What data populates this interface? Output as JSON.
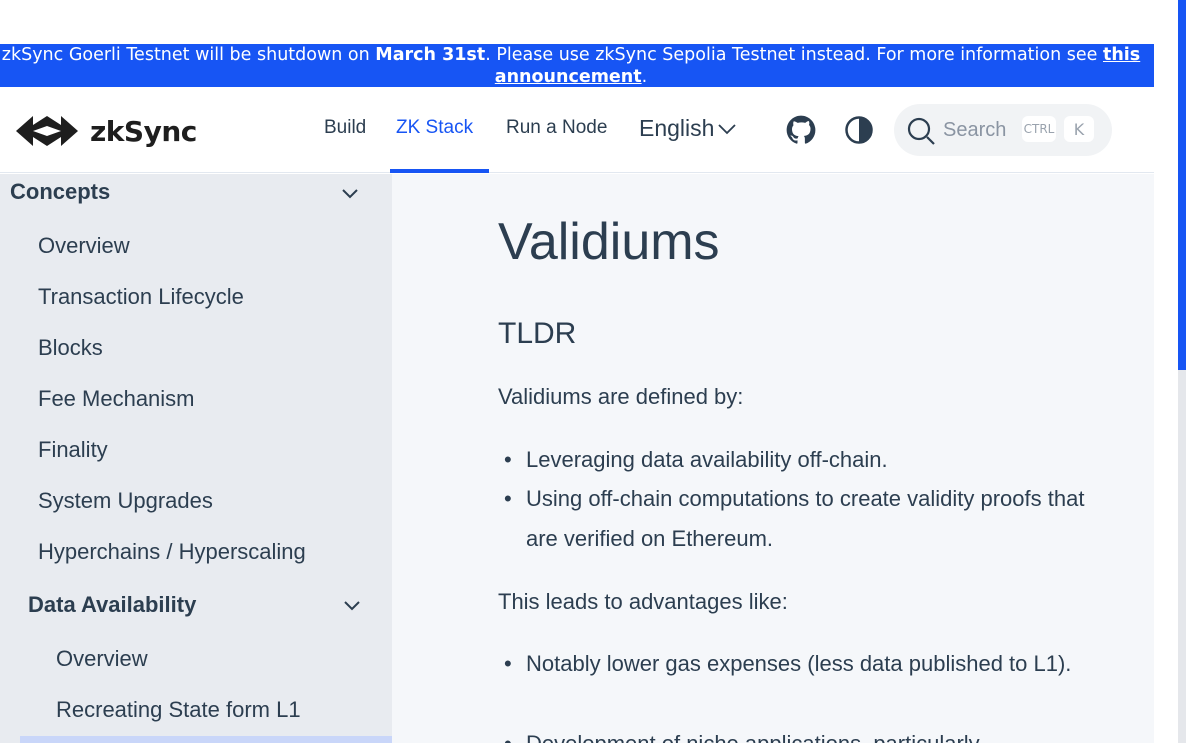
{
  "banner": {
    "prefix": "zkSync Goerli Testnet will be shutdown on ",
    "date": "March 31st",
    "middle": ". Please use zkSync Sepolia Testnet instead. For more information see ",
    "link": "this announcement",
    "suffix": "."
  },
  "header": {
    "logo_text": "zkSync",
    "nav": [
      {
        "label": "Build"
      },
      {
        "label": "ZK Stack"
      },
      {
        "label": "Run a Node"
      }
    ],
    "language": "English",
    "search": {
      "placeholder": "Search",
      "kbd_ctrl": "CTRL",
      "kbd_key": "K"
    }
  },
  "sidebar": {
    "section_title": "Concepts",
    "items": [
      {
        "label": "Overview"
      },
      {
        "label": "Transaction Lifecycle"
      },
      {
        "label": "Blocks"
      },
      {
        "label": "Fee Mechanism"
      },
      {
        "label": "Finality"
      },
      {
        "label": "System Upgrades"
      },
      {
        "label": "Hyperchains / Hyperscaling"
      }
    ],
    "subsection_title": "Data Availability",
    "sub_items": [
      {
        "label": "Overview"
      },
      {
        "label": "Recreating State form L1"
      }
    ]
  },
  "content": {
    "title": "Validiums",
    "h2": "TLDR",
    "intro": "Validiums are defined by:",
    "defined_by": [
      "Leveraging data availability off-chain.",
      "Using off-chain computations to create validity proofs that are verified on Ethereum."
    ],
    "advantages_intro": "This leads to advantages like:",
    "advantages": [
      "Notably lower gas expenses (less data published to L1).",
      "Development of niche applications, particularly"
    ]
  },
  "colors": {
    "accent": "#1755f4",
    "sidebar_bg": "#e8ebf0",
    "content_bg": "#f5f7fa",
    "text": "#2c3e50"
  }
}
